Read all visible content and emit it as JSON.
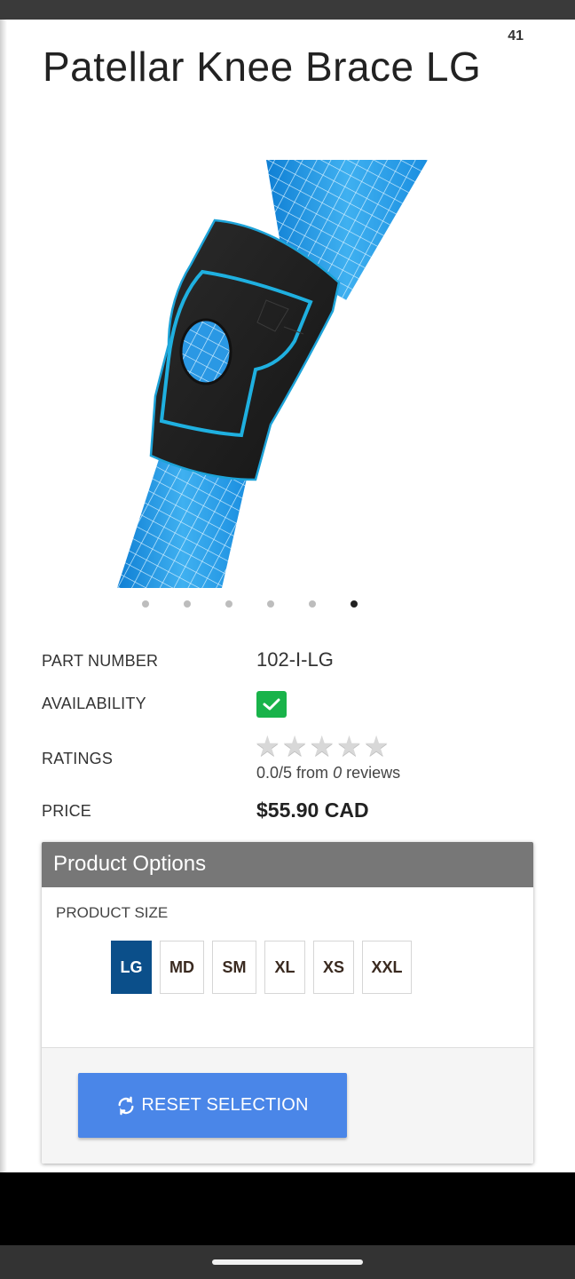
{
  "page_badge": "41",
  "product": {
    "title": "Patellar Knee Brace LG"
  },
  "carousel": {
    "count": 6,
    "active_index": 5
  },
  "specs": {
    "part_number_label": "PART NUMBER",
    "part_number_value": "102-I-LG",
    "availability_label": "AVAILABILITY",
    "availability_in_stock": true,
    "ratings_label": "RATINGS",
    "rating_score": "0.0/5 from",
    "rating_count": "0",
    "rating_suffix": "reviews",
    "stars_filled": 0,
    "stars_total": 5,
    "price_label": "PRICE",
    "price_value": "$55.90 CAD"
  },
  "options": {
    "header": "Product Options",
    "size_label": "PRODUCT SIZE",
    "sizes": [
      "LG",
      "MD",
      "SM",
      "XL",
      "XS",
      "XXL"
    ],
    "selected_size": "LG",
    "reset_label": "RESET SELECTION"
  },
  "colors": {
    "selected_size": "#0b4f8a",
    "reset_button": "#4a86e8",
    "availability": "#19b34a",
    "options_header": "#777777"
  }
}
